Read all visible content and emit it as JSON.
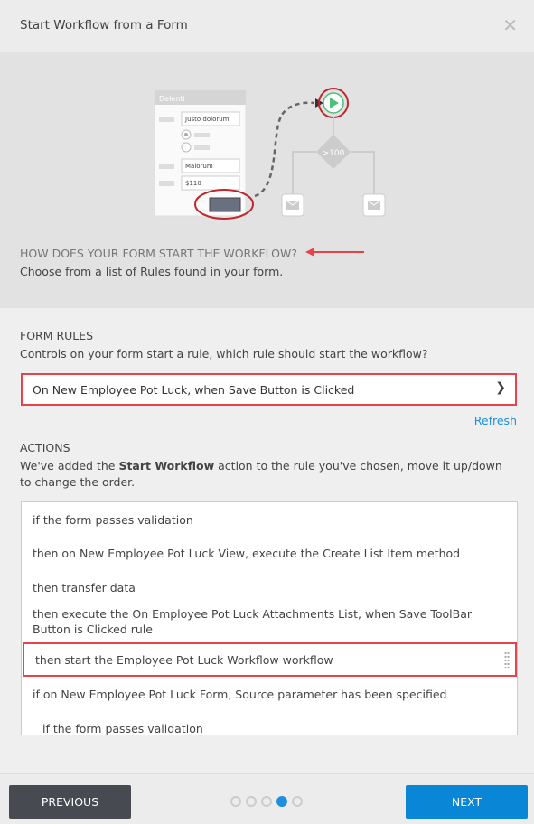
{
  "dialog": {
    "title": "Start Workflow from a Form",
    "close_icon": "close-icon"
  },
  "hero": {
    "form_title": "Delenti",
    "field1": "Justo dolorum",
    "field2": "Maiorum",
    "field3": "$110",
    "decision": ">100",
    "question": "HOW DOES YOUR FORM START THE WORKFLOW?",
    "description": "Choose from a list of Rules found in your form."
  },
  "form_rules": {
    "heading": "FORM RULES",
    "description": "Controls on your form start a rule, which rule should start the workflow?",
    "selected": "On New Employee Pot Luck, when Save Button is Clicked",
    "refresh": "Refresh"
  },
  "actions": {
    "heading": "ACTIONS",
    "desc_pre": "We've added the ",
    "desc_bold": "Start Workflow",
    "desc_post": " action to the rule you've chosen, move it up/down to change the order.",
    "items": [
      "if the form passes validation",
      "then on New Employee Pot Luck View, execute the Create List Item method",
      "then transfer data",
      "then execute the On Employee Pot Luck Attachments List, when Save ToolBar Button is Clicked rule",
      "then start the Employee Pot Luck Workflow workflow",
      "if on New Employee Pot Luck Form, Source parameter has been specified",
      "if the form passes validation"
    ],
    "selected_index": 4
  },
  "footer": {
    "previous": "PREVIOUS",
    "next": "NEXT",
    "steps": 5,
    "current_step": 4
  },
  "colors": {
    "accent": "#1e8fe0",
    "highlight": "#e8434b",
    "next_button": "#0986d6",
    "previous_button": "#474a51"
  }
}
